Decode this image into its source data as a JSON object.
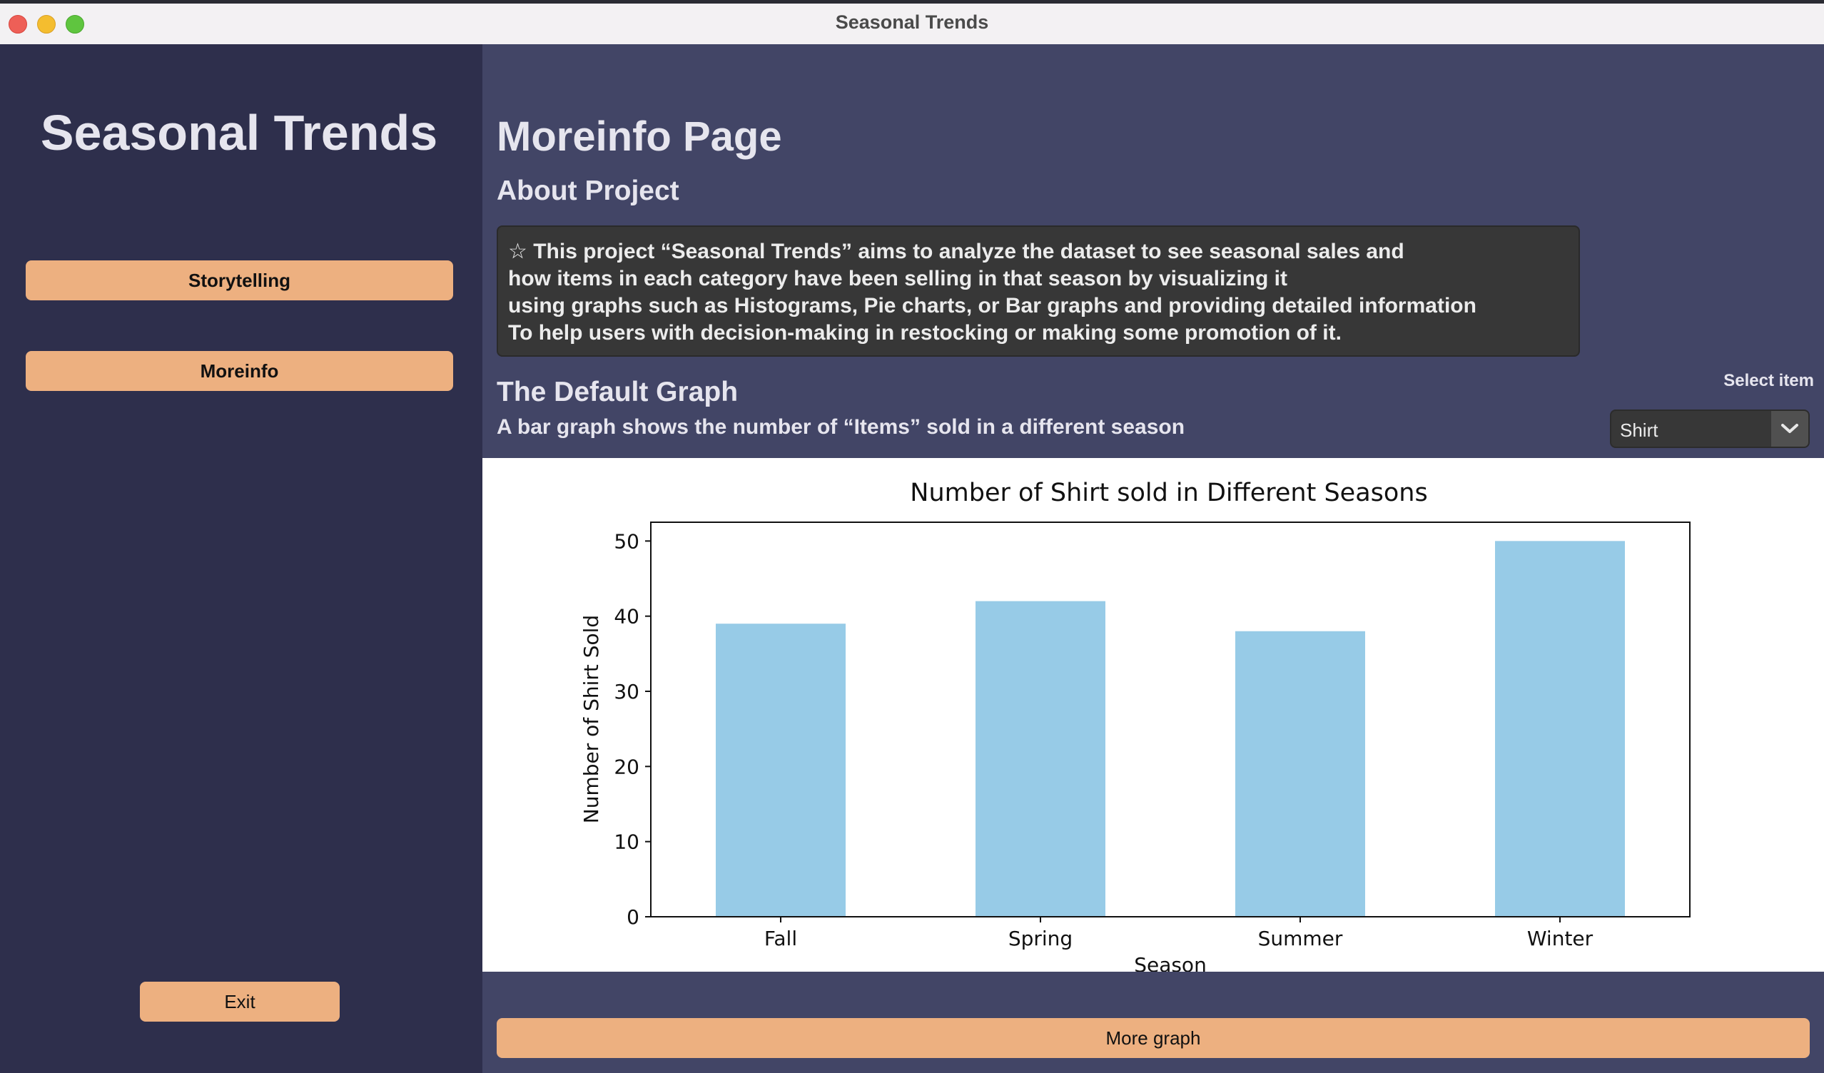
{
  "window": {
    "title": "Seasonal Trends"
  },
  "sidebar": {
    "app_title": "Seasonal Trends",
    "buttons": [
      {
        "label": "Storytelling"
      },
      {
        "label": "Moreinfo"
      }
    ],
    "exit_label": "Exit"
  },
  "main": {
    "page_title": "Moreinfo Page",
    "about_title": "About Project",
    "about_lines": [
      "☆ This project “Seasonal Trends” aims to analyze the dataset to see seasonal sales and",
      "how items in each category have been selling in that season by visualizing it",
      "using graphs such as Histograms, Pie charts, or Bar graphs and providing detailed information",
      "To help users with decision-making in restocking or making some promotion of it."
    ],
    "graph_title": "The Default Graph",
    "graph_desc": "A bar graph shows the number of “Items” sold in a different season",
    "select_label": "Select item",
    "select_value": "Shirt",
    "more_graph_label": "More graph"
  },
  "colors": {
    "accent": "#edb080",
    "sidebar_bg": "#2e2f4c",
    "main_bg": "#424566",
    "bar": "#97cbe7"
  },
  "chart_data": {
    "type": "bar",
    "title": "Number of Shirt sold in Different Seasons",
    "xlabel": "Season",
    "ylabel": "Number of Shirt Sold",
    "categories": [
      "Fall",
      "Spring",
      "Summer",
      "Winter"
    ],
    "values": [
      39,
      42,
      38,
      50
    ],
    "ylim": [
      0,
      52.5
    ],
    "yticks": [
      0,
      10,
      20,
      30,
      40,
      50
    ],
    "grid": false,
    "legend": false
  }
}
